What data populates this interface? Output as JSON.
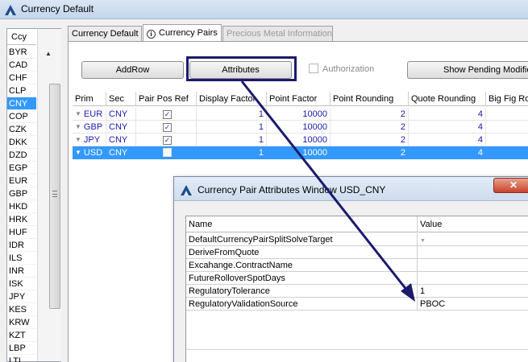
{
  "window": {
    "title": "Currency Default",
    "logo": "app-logo-icon"
  },
  "currency_list": {
    "header": "Ccy",
    "items": [
      "BYR",
      "CAD",
      "CHF",
      "CLP",
      "CNY",
      "COP",
      "CZK",
      "DKK",
      "DZD",
      "EGP",
      "EUR",
      "GBP",
      "HKD",
      "HRK",
      "HUF",
      "IDR",
      "ILS",
      "INR",
      "ISK",
      "JPY",
      "KES",
      "KRW",
      "KZT",
      "LBP",
      "LTL"
    ],
    "selected": "CNY"
  },
  "tabs": [
    {
      "label": "Currency Default",
      "state": "normal"
    },
    {
      "label": "Currency Pairs",
      "state": "active",
      "icon": "info-icon"
    },
    {
      "label": "Precious Metal Information",
      "state": "disabled"
    }
  ],
  "toolbar": {
    "add_row": "AddRow",
    "attributes": "Attributes",
    "authorization": "Authorization",
    "show_pending": "Show Pending Modifica"
  },
  "grid": {
    "columns": [
      "Prim",
      "Sec",
      "Pair Pos Ref",
      "Display Factor",
      "Point Factor",
      "Point Rounding",
      "Quote Rounding",
      "Big Fig Ro"
    ],
    "rows": [
      {
        "prim": "EUR",
        "sec": "CNY",
        "pair_pos_ref": true,
        "display_factor": "1",
        "point_factor": "10000",
        "point_rounding": "2",
        "quote_rounding": "4",
        "selected": false
      },
      {
        "prim": "GBP",
        "sec": "CNY",
        "pair_pos_ref": true,
        "display_factor": "1",
        "point_factor": "10000",
        "point_rounding": "2",
        "quote_rounding": "4",
        "selected": false
      },
      {
        "prim": "JPY",
        "sec": "CNY",
        "pair_pos_ref": true,
        "display_factor": "1",
        "point_factor": "10000",
        "point_rounding": "2",
        "quote_rounding": "4",
        "selected": false
      },
      {
        "prim": "USD",
        "sec": "CNY",
        "pair_pos_ref": false,
        "display_factor": "1",
        "point_factor": "10000",
        "point_rounding": "2",
        "quote_rounding": "4",
        "selected": true
      }
    ]
  },
  "popup": {
    "title": "Currency Pair Attributes Window USD_CNY",
    "close_label": "✕",
    "columns": [
      "Name",
      "Value"
    ],
    "rows": [
      {
        "name": "DefaultCurrencyPairSplitSolveTarget",
        "value": "",
        "dropdown": true
      },
      {
        "name": "DeriveFromQuote",
        "value": ""
      },
      {
        "name": "Excahange.ContractName",
        "value": ""
      },
      {
        "name": "FutureRolloverSpotDays",
        "value": ""
      },
      {
        "name": "RegulatoryTolerance",
        "value": "1"
      },
      {
        "name": "RegulatoryValidationSource",
        "value": "PBOC"
      }
    ]
  },
  "colors": {
    "selection": "#3399ff",
    "annotation": "#1a1a6e",
    "value_text": "#1a1ab0"
  }
}
